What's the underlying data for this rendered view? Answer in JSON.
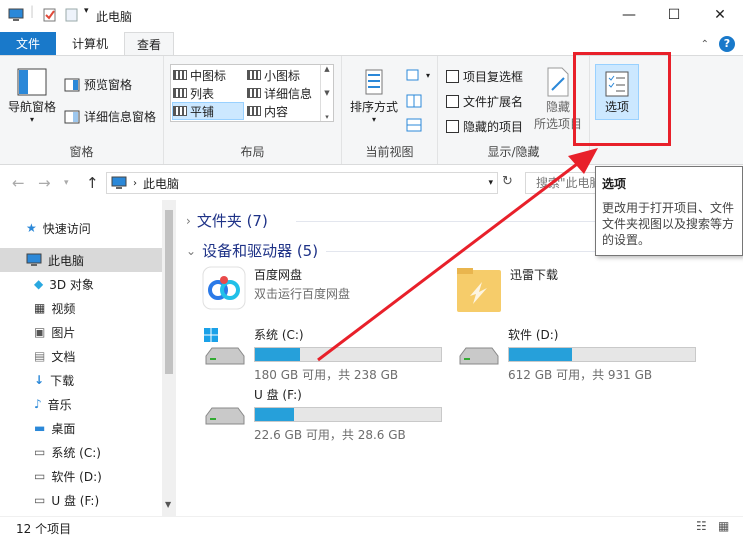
{
  "window": {
    "title": "此电脑"
  },
  "tabs": {
    "file": "文件",
    "computer": "计算机",
    "view": "查看"
  },
  "ribbon": {
    "panes": {
      "label": "窗格",
      "nav_pane": "导航窗格",
      "preview_pane": "预览窗格",
      "details_pane": "详细信息窗格"
    },
    "layout": {
      "label": "布局",
      "items": [
        "中图标",
        "小图标",
        "列表",
        "详细信息",
        "平铺",
        "内容"
      ],
      "selected": "平铺"
    },
    "current_view": {
      "label": "当前视图",
      "sort_by": "排序方式"
    },
    "show_hide": {
      "label": "显示/隐藏",
      "item_checkboxes": "项目复选框",
      "file_extensions": "文件扩展名",
      "hidden_items": "隐藏的项目",
      "hide_selected_line1": "隐藏",
      "hide_selected_line2": "所选项目"
    },
    "options": {
      "label": "选项"
    }
  },
  "address": {
    "path": "此电脑",
    "search_placeholder": "搜索\"此电脑\""
  },
  "nav": {
    "items": [
      {
        "label": "快速访问",
        "icon": "star-icon"
      },
      {
        "label": "此电脑",
        "icon": "computer-icon"
      },
      {
        "label": "3D 对象",
        "icon": "cube-icon"
      },
      {
        "label": "视频",
        "icon": "video-icon"
      },
      {
        "label": "图片",
        "icon": "image-icon"
      },
      {
        "label": "文档",
        "icon": "document-icon"
      },
      {
        "label": "下载",
        "icon": "download-icon"
      },
      {
        "label": "音乐",
        "icon": "music-icon"
      },
      {
        "label": "桌面",
        "icon": "desktop-icon"
      },
      {
        "label": "系统 (C:)",
        "icon": "drive-c-icon"
      },
      {
        "label": "软件 (D:)",
        "icon": "drive-icon"
      },
      {
        "label": "U 盘 (F:)",
        "icon": "usb-drive-icon"
      }
    ]
  },
  "content": {
    "folders_header": "文件夹 (7)",
    "devices_header": "设备和驱动器 (5)",
    "apps": [
      {
        "name": "百度网盘",
        "sub": "双击运行百度网盘"
      },
      {
        "name": "迅雷下载",
        "sub": ""
      }
    ],
    "drives": [
      {
        "name": "系统 (C:)",
        "info": "180 GB 可用，共 238 GB",
        "used_fraction": 0.24
      },
      {
        "name": "软件 (D:)",
        "info": "612 GB 可用，共 931 GB",
        "used_fraction": 0.34
      },
      {
        "name": "U 盘 (F:)",
        "info": "22.6 GB 可用，共 28.6 GB",
        "used_fraction": 0.21
      }
    ]
  },
  "tooltip": {
    "title": "选项",
    "line1": "更改用于打开项目、文件",
    "line2": "文件夹视图以及搜索等方",
    "line3": "的设置。"
  },
  "status": {
    "count": "12 个项目"
  },
  "colors": {
    "accent": "#1979ca",
    "annotation": "#e8202a",
    "bar_fill": "#26a0da"
  }
}
